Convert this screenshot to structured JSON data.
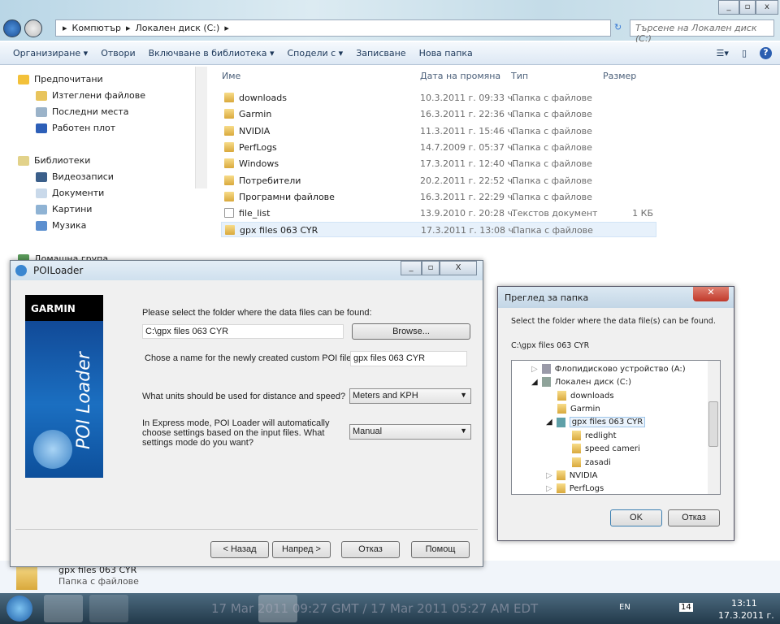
{
  "explorer": {
    "breadcrumb": [
      "Компютър",
      "Локален диск (C:)"
    ],
    "search_placeholder": "Търсене на Локален диск (C:)",
    "toolbar": [
      "Организиране ▾",
      "Отвори",
      "Включване в библиотека ▾",
      "Сподели с ▾",
      "Записване",
      "Нова папка"
    ],
    "nav": {
      "favorites": "Предпочитани",
      "fav_items": [
        "Изтеглени файлове",
        "Последни места",
        "Работен плот"
      ],
      "libraries": "Библиотеки",
      "lib_items": [
        "Видеозаписи",
        "Документи",
        "Картини",
        "Музика"
      ],
      "homegroup": "Домашна група"
    },
    "columns": [
      "Име",
      "Дата на промяна",
      "Тип",
      "Размер"
    ],
    "files": [
      {
        "name": "downloads",
        "date": "10.3.2011 г. 09:33 ч.",
        "type": "Папка с файлове",
        "size": ""
      },
      {
        "name": "Garmin",
        "date": "16.3.2011 г. 22:36 ч.",
        "type": "Папка с файлове",
        "size": ""
      },
      {
        "name": "NVIDIA",
        "date": "11.3.2011 г. 15:46 ч.",
        "type": "Папка с файлове",
        "size": ""
      },
      {
        "name": "PerfLogs",
        "date": "14.7.2009 г. 05:37 ч.",
        "type": "Папка с файлове",
        "size": ""
      },
      {
        "name": "Windows",
        "date": "17.3.2011 г. 12:40 ч.",
        "type": "Папка с файлове",
        "size": ""
      },
      {
        "name": "Потребители",
        "date": "20.2.2011 г. 22:52 ч.",
        "type": "Папка с файлове",
        "size": ""
      },
      {
        "name": "Програмни файлове",
        "date": "16.3.2011 г. 22:29 ч.",
        "type": "Папка с файлове",
        "size": ""
      },
      {
        "name": "file_list",
        "date": "13.9.2010 г. 20:28 ч.",
        "type": "Текстов документ",
        "size": "1 КБ"
      },
      {
        "name": "gpx files 063 CYR",
        "date": "17.3.2011 г. 13:08 ч.",
        "type": "Папка с файлове",
        "size": ""
      }
    ],
    "details_type": "Папка с файлове"
  },
  "poi": {
    "title": "POILoader",
    "brand": "GARMIN",
    "product": "POI Loader",
    "folder_label": "Please select the folder where the data files can be found:",
    "folder_value": "C:\\gpx files 063 CYR",
    "browse": "Browse...",
    "name_label": "Chose a name for the newly created custom POI file:",
    "name_value": "gpx files 063 CYR",
    "units_label": "What units should be used for distance and speed?",
    "units_value": "Meters and KPH",
    "mode_label": "In Express mode, POI Loader will automatically choose settings based on the input files. What settings mode do you want?",
    "mode_value": "Manual",
    "buttons": [
      "< Назад",
      "Напред >",
      "Отказ",
      "Помощ"
    ]
  },
  "browse": {
    "title": "Преглед за папка",
    "prompt": "Select the folder where the data file(s) can be found.",
    "path": "C:\\gpx files 063 CYR",
    "tree": [
      "Флопидисково устройство (A:)",
      "Локален диск (C:)",
      "downloads",
      "Garmin",
      "gpx files 063 CYR",
      "redlight",
      "speed cameri",
      "zasadi",
      "NVIDIA",
      "PerfLogs"
    ],
    "ok": "OK",
    "cancel": "Отказ"
  },
  "taskbar": {
    "lang": "EN",
    "badge": "14",
    "time": "13:11",
    "date": "17.3.2011 г.",
    "banner": "17 Mar 2011 09:27 GMT / 17 Mar 2011 05:27 AM EDT"
  }
}
